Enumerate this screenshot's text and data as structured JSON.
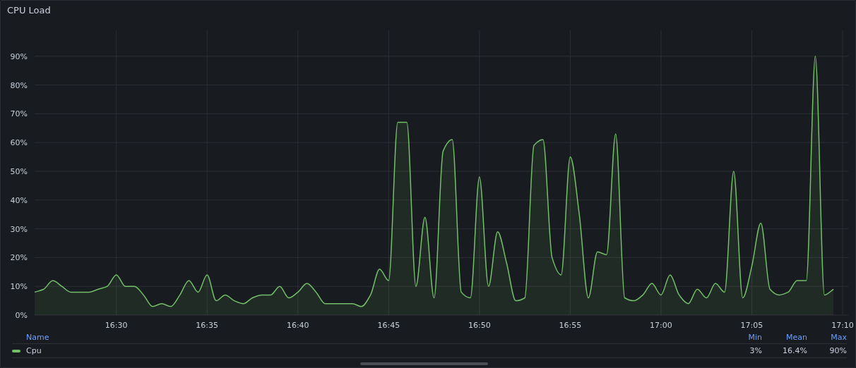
{
  "panel": {
    "title": "CPU Load",
    "chart_data": {
      "type": "area",
      "grid": true,
      "ylim": [
        0,
        99
      ],
      "yticks": [
        {
          "value": 0,
          "label": "0%"
        },
        {
          "value": 10,
          "label": "10%"
        },
        {
          "value": 20,
          "label": "20%"
        },
        {
          "value": 30,
          "label": "30%"
        },
        {
          "value": 40,
          "label": "40%"
        },
        {
          "value": 50,
          "label": "50%"
        },
        {
          "value": 60,
          "label": "60%"
        },
        {
          "value": 70,
          "label": "70%"
        },
        {
          "value": 80,
          "label": "80%"
        },
        {
          "value": 90,
          "label": "90%"
        }
      ],
      "categories": [
        null,
        null,
        null,
        null,
        null,
        null,
        null,
        null,
        null,
        "16:30",
        null,
        null,
        null,
        null,
        null,
        null,
        null,
        null,
        null,
        "16:35",
        null,
        null,
        null,
        null,
        null,
        null,
        null,
        null,
        null,
        "16:40",
        null,
        null,
        null,
        null,
        null,
        null,
        null,
        null,
        null,
        "16:45",
        null,
        null,
        null,
        null,
        null,
        null,
        null,
        null,
        null,
        "16:50",
        null,
        null,
        null,
        null,
        null,
        null,
        null,
        null,
        null,
        "16:55",
        null,
        null,
        null,
        null,
        null,
        null,
        null,
        null,
        null,
        "17:00",
        null,
        null,
        null,
        null,
        null,
        null,
        null,
        null,
        null,
        "17:05",
        null,
        null,
        null,
        null,
        null,
        null,
        null,
        null,
        null,
        "17:10"
      ],
      "series": [
        {
          "color": "#73bf69",
          "values": [
            8,
            9,
            12,
            10,
            8,
            8,
            8,
            9,
            10,
            14,
            10,
            10,
            7,
            3,
            4,
            3,
            7,
            12,
            8,
            14,
            5,
            7,
            5,
            4,
            6,
            7,
            7,
            10,
            6,
            8,
            11,
            8,
            4,
            4,
            4,
            4,
            3,
            7,
            16,
            12,
            67,
            67,
            10,
            34,
            6,
            57,
            61,
            8,
            6,
            48,
            10,
            29,
            18,
            5,
            6,
            59,
            61,
            20,
            14,
            55,
            35,
            6,
            22,
            21,
            63,
            6,
            5,
            7,
            11,
            7,
            14,
            7,
            4,
            9,
            6,
            11,
            8,
            50,
            6,
            17,
            32,
            9,
            7,
            8,
            12,
            12,
            90,
            7,
            9,
            null
          ]
        }
      ]
    }
  },
  "legend": {
    "columns": [
      "Name",
      "Min",
      "Mean",
      "Max"
    ],
    "rows": [
      {
        "name": "Cpu",
        "min": "3%",
        "mean": "16.4%",
        "max": "90%"
      }
    ]
  }
}
